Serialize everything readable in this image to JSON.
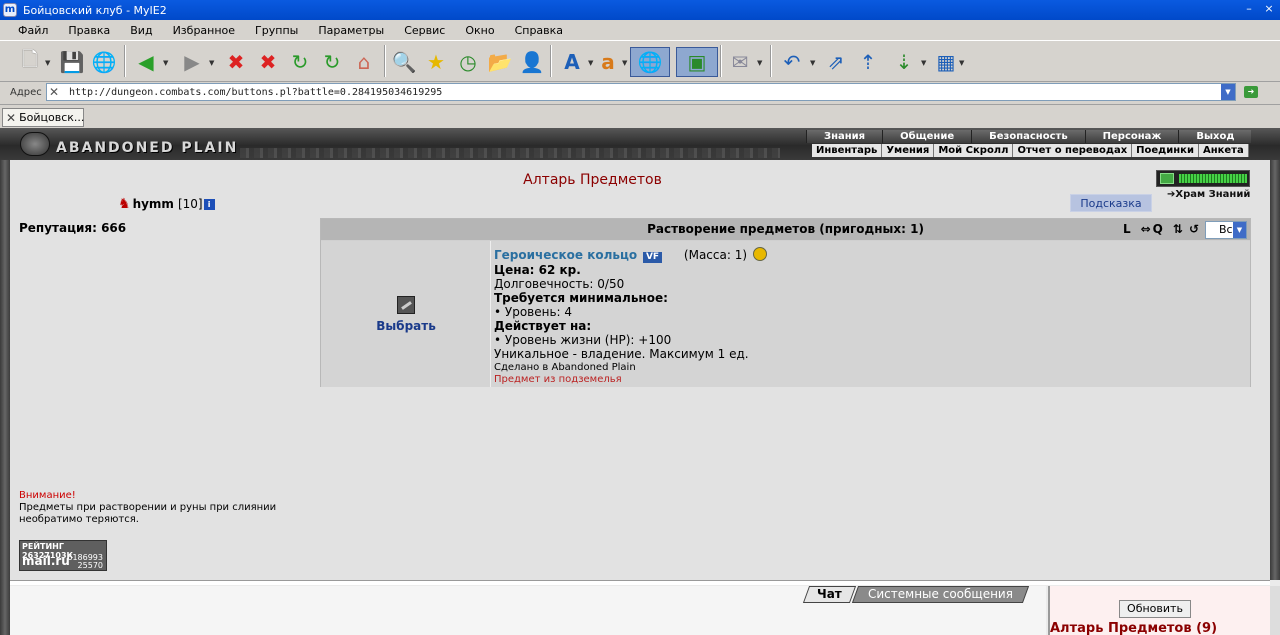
{
  "window": {
    "title": "Бойцовский клуб - MyIE2",
    "app_icon": "myie2-icon"
  },
  "menu": [
    "Файл",
    "Правка",
    "Вид",
    "Избранное",
    "Группы",
    "Параметры",
    "Сервис",
    "Окно",
    "Справка"
  ],
  "address": {
    "label": "Адрес",
    "url": "http://dungeon.combats.com/buttons.pl?battle=0.284195034619295"
  },
  "tabs": [
    {
      "label": "Бойцовск..."
    }
  ],
  "site": {
    "logo": "ABANDONED PLAIN",
    "topnav": [
      "Знания",
      "Общение",
      "Безопасность",
      "Персонаж",
      "Выход"
    ],
    "subnav": [
      "Инвентарь",
      "Умения",
      "Мой Скролл",
      "Отчет о переводах",
      "Поединки",
      "Анкета"
    ]
  },
  "page": {
    "title": "Алтарь Предметов",
    "character": {
      "nick": "hymm",
      "level": "[10]",
      "info_badge": "i"
    },
    "reputation": "Репутация: 666",
    "hram_link": "Храм Знаний",
    "hint_button": "Подсказка",
    "panel": {
      "header": "Растворение предметов (пригодных: 1)",
      "controls": [
        "L",
        "⇔",
        "Q",
        "⇅",
        "↺"
      ],
      "filter": "Все"
    },
    "item": {
      "choose": "Выбрать",
      "name": "Героическое кольцо",
      "badge": "VF",
      "mass": "(Масса: 1)",
      "price": "Цена: 62 кр.",
      "durability": "Долговечность: 0/50",
      "req_title": "Требуется минимальное:",
      "req_level": "• Уровень: 4",
      "effect_title": "Действует на:",
      "effect_hp": "• Уровень жизни (HP): +100",
      "unique": "Уникальное - владение. Максимум 1 ед.",
      "made_in": "Сделано в Abandoned Plain",
      "dungeon": "Предмет из подземелья"
    },
    "warning": {
      "title": "Внимание!",
      "line1": "Предметы при растворении и руны при слиянии",
      "line2": "необратимо теряются."
    },
    "counter": {
      "line1": "РЕЙТИНГ 26327103К",
      "brand": "mail.ru",
      "n1": "6186993",
      "n2": "25570"
    }
  },
  "bottom": {
    "chat_tab": "Чат",
    "system_tab": "Системные сообщения",
    "refresh": "Обновить",
    "room": "Алтарь Предметов (9)"
  }
}
